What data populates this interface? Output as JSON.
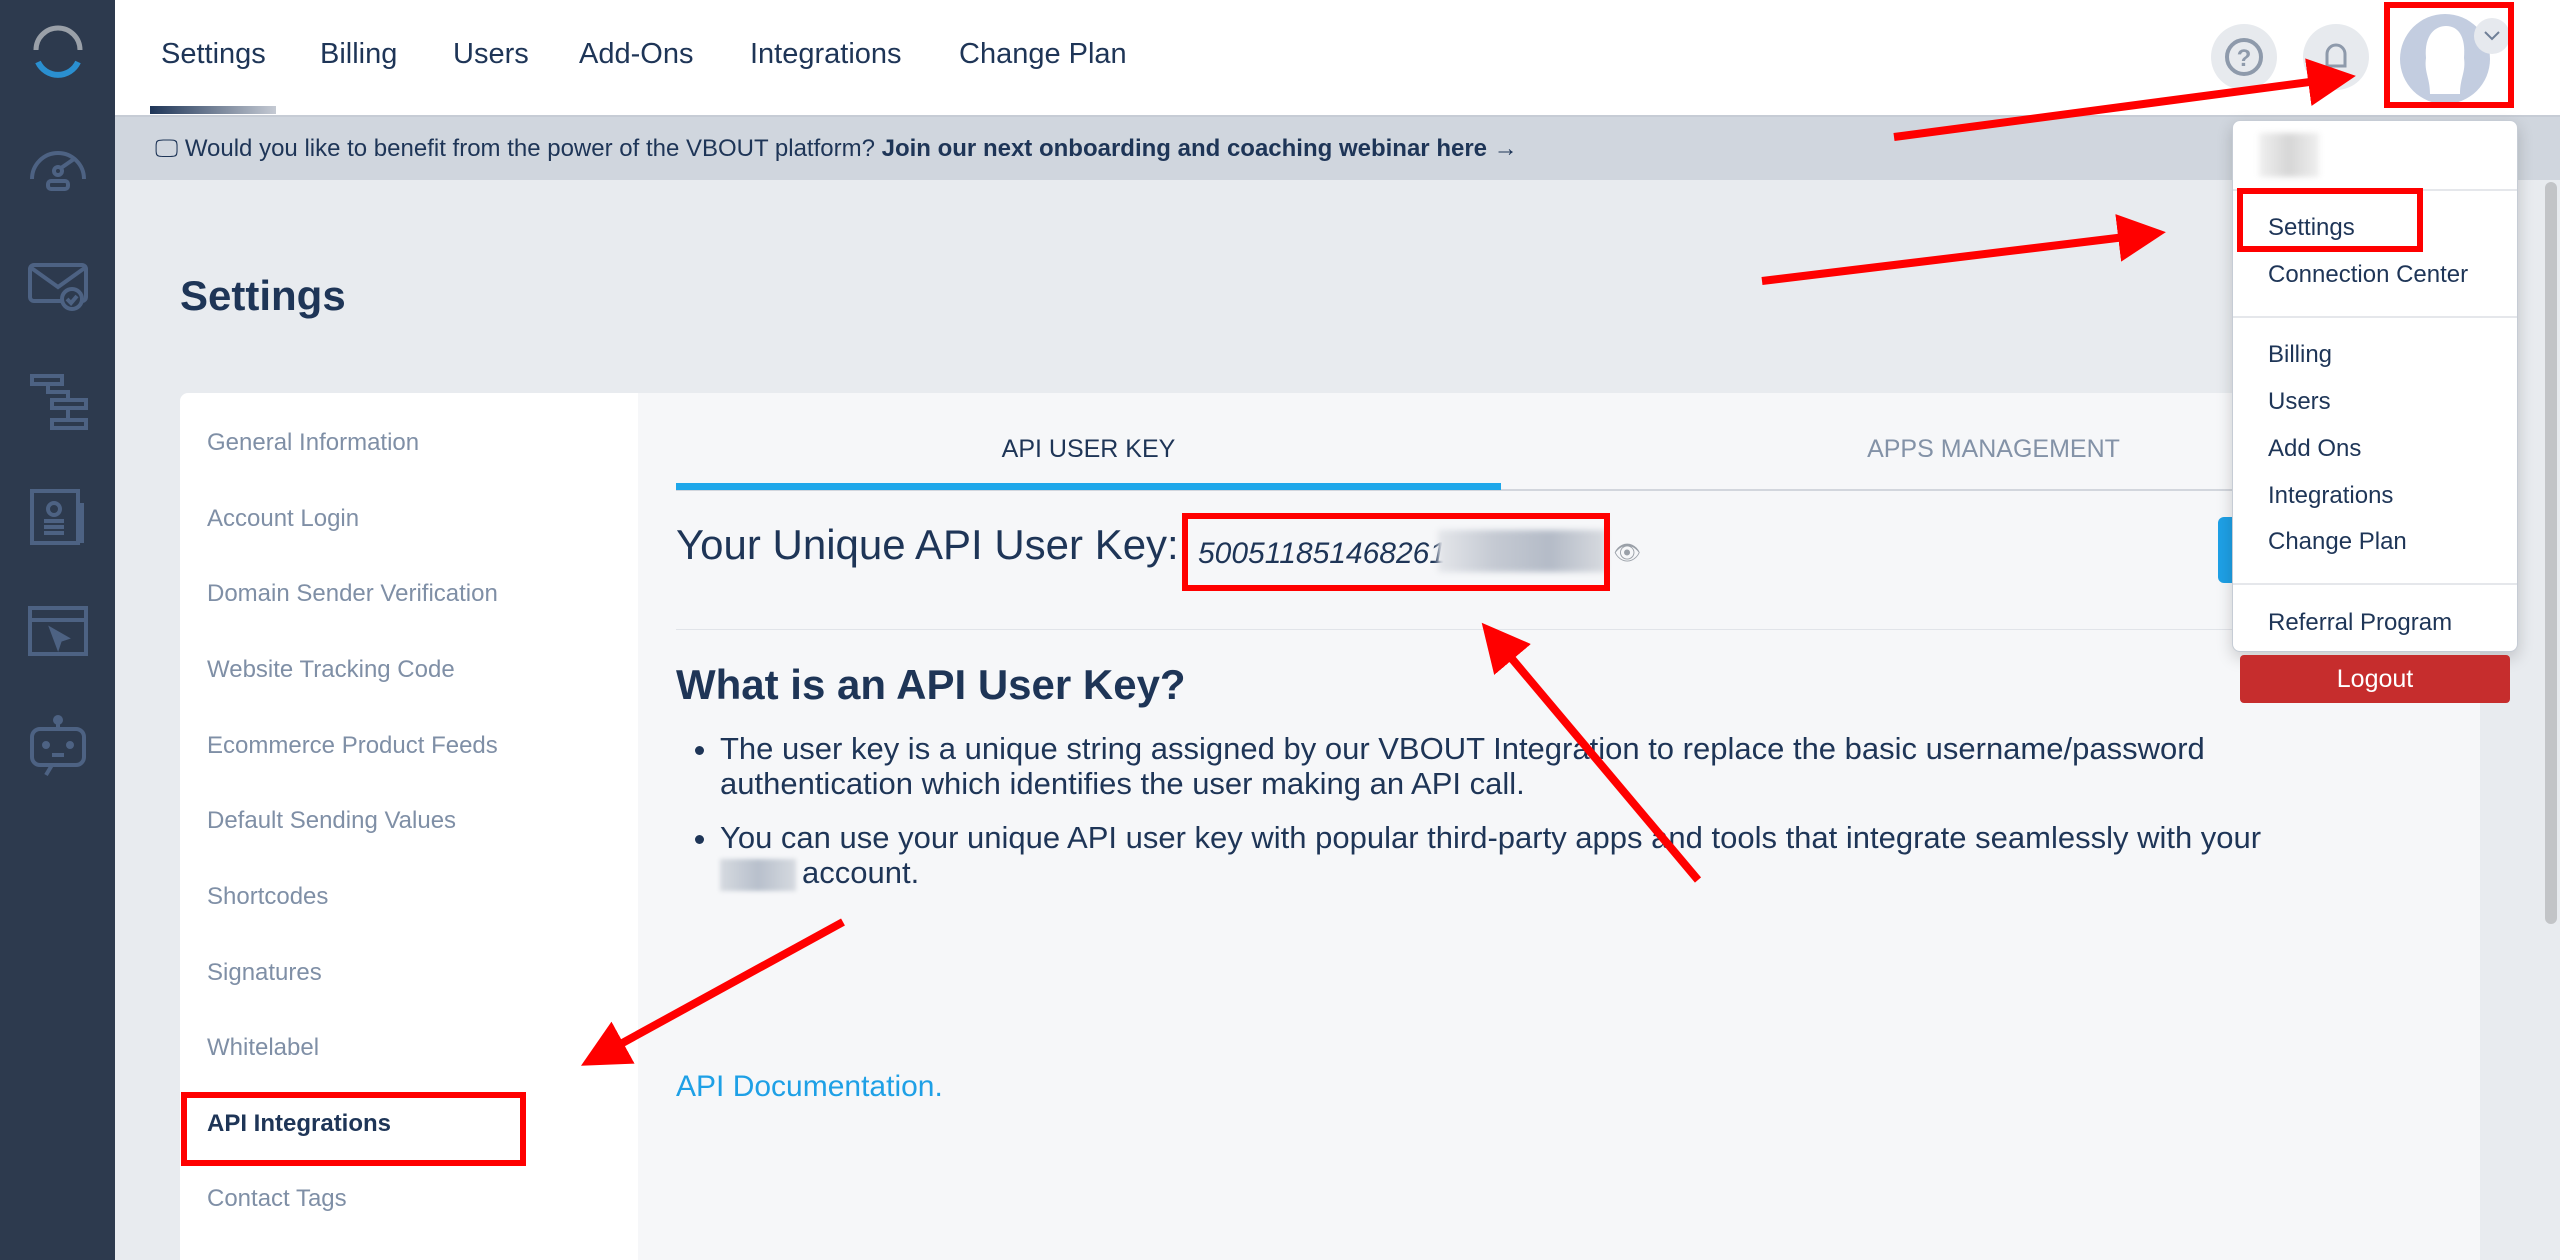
{
  "rail": {
    "icons": [
      "logo-icon",
      "dashboard-gauge-icon",
      "email-check-icon",
      "workflow-icon",
      "contacts-icon",
      "website-cursor-icon",
      "chatbot-icon"
    ]
  },
  "topnav": {
    "tabs": [
      "Settings",
      "Billing",
      "Users",
      "Add-Ons",
      "Integrations",
      "Change Plan"
    ],
    "active_tab": "Settings",
    "help_icon": "question-circle-icon",
    "notification_icon": "bell-icon",
    "avatar_icon": "user-avatar-icon"
  },
  "banner": {
    "text": "Would you like to benefit from the power of the VBOUT platform?",
    "link": "Join our next onboarding and coaching webinar here →",
    "close": "✕"
  },
  "page": {
    "title": "Settings"
  },
  "settings_menu": {
    "items": [
      "General Information",
      "Account Login",
      "Domain Sender Verification",
      "Website Tracking Code",
      "Ecommerce Product Feeds",
      "Default Sending Values",
      "Shortcodes",
      "Signatures",
      "Whitelabel",
      "API Integrations",
      "Contact Tags"
    ],
    "active": "API Integrations"
  },
  "content": {
    "tabs": [
      "API USER KEY",
      "APPS MANAGEMENT"
    ],
    "active_tab": "API USER KEY",
    "key_label": "Your Unique API User Key:",
    "key_value": "500511851468261",
    "heading": "What is an API User Key?",
    "bullets": [
      "The user key is a unique string assigned by our VBOUT Integration to replace the basic username/password authentication which identifies the user making an API call.",
      "You can use your unique API user key with popular third-party apps and tools that integrate seamlessly with your"
    ],
    "bullet2_suffix": "account.",
    "doc_link": "API Documentation."
  },
  "dropdown": {
    "group1": [
      "Settings",
      "Connection Center"
    ],
    "group2": [
      "Billing",
      "Users",
      "Add Ons",
      "Integrations",
      "Change Plan"
    ],
    "group3": [
      "Referral Program"
    ],
    "logout": "Logout"
  },
  "colors": {
    "accent_blue": "#1ea7ea",
    "navy": "#1e3557",
    "rail": "#2d3a4e",
    "logout_red": "#c62d2d",
    "annotation_red": "#ff0000"
  }
}
